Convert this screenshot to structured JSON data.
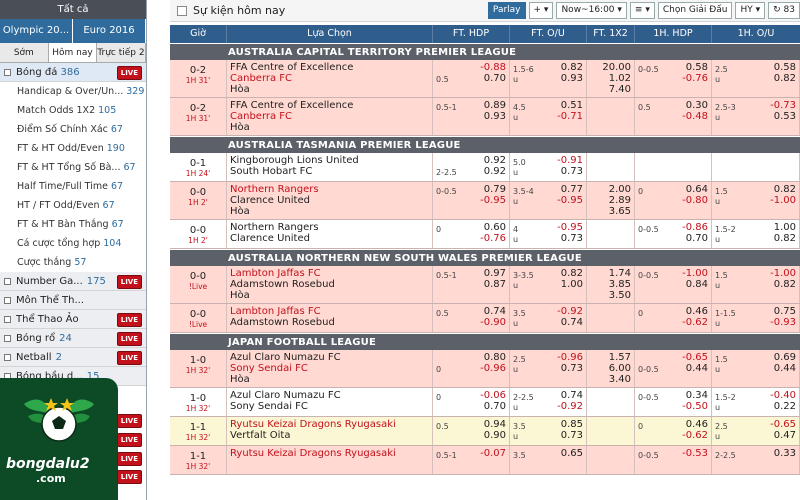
{
  "sidebar": {
    "top_label": "Tất cả",
    "tabs_row1": [
      "Olympic 20...",
      "Euro 2016"
    ],
    "tabs_row2": [
      "Sớm",
      "Hôm nay",
      "Trực tiếp 28"
    ],
    "football": {
      "label": "Bóng đá",
      "count": "386",
      "live": "LIVE"
    },
    "sub_items": [
      {
        "label": "Handicap & Over/Un...",
        "count": "329"
      },
      {
        "label": "Match Odds 1X2",
        "count": "105"
      },
      {
        "label": "Điểm Số Chính Xác",
        "count": "67"
      },
      {
        "label": "FT & HT Odd/Even",
        "count": "190"
      },
      {
        "label": "FT & HT Tổng Số Bà...",
        "count": "67"
      },
      {
        "label": "Half Time/Full Time",
        "count": "67"
      },
      {
        "label": "HT / FT Odd/Even",
        "count": "67"
      },
      {
        "label": "FT & HT Bàn Thắng",
        "count": "67"
      },
      {
        "label": "Cá cược tổng hợp",
        "count": "104"
      },
      {
        "label": "Cược thắng",
        "count": "57"
      }
    ],
    "cats": [
      {
        "label": "Number Ga...",
        "count": "175",
        "live": "LIVE"
      },
      {
        "label": "Môn Thể Th...",
        "count": "",
        "live": ""
      },
      {
        "label": "Thể Thao Ảo",
        "count": "",
        "live": "LIVE"
      },
      {
        "label": "Bóng rổ",
        "count": "24",
        "live": "LIVE"
      },
      {
        "label": "Netball",
        "count": "2",
        "live": "LIVE"
      },
      {
        "label": "Bóng bầu d...",
        "count": "15",
        "live": ""
      }
    ],
    "extra_live": [
      "LIVE",
      "LIVE",
      "LIVE",
      "LIVE"
    ],
    "logo_text": "bongdalu2",
    "logo_domain": ".com"
  },
  "toolbar": {
    "title": "Sự kiện hôm nay",
    "parlay": "Parlay",
    "plus": "+",
    "time_select": "Now~16:00",
    "sort": "≡",
    "choose_league": "Chọn Giải Đấu",
    "odds_type": "HY",
    "refresh": "83"
  },
  "columns": [
    "Giờ",
    "Lựa Chọn",
    "FT. HDP",
    "FT. O/U",
    "FT. 1X2",
    "1H. HDP",
    "1H. O/U"
  ],
  "leagues": [
    {
      "name": "AUSTRALIA CAPITAL TERRITORY PREMIER LEAGUE",
      "matches": [
        {
          "bg": "pink",
          "score": "0-2",
          "min": "1H 31'",
          "home": "FFA Centre of Excellence",
          "away": "Canberra FC",
          "draw": "Hòa",
          "homeRed": false,
          "awayRed": true,
          "hdp": [
            "",
            "-0.88",
            "0.5",
            "0.70"
          ],
          "ou": [
            "1.5-6",
            "0.82",
            "u",
            "0.93"
          ],
          "x12": [
            "20.00",
            "1.02",
            "7.40"
          ],
          "h1": [
            "0-0.5",
            "0.58",
            "",
            "-0.76"
          ],
          "h1ou": [
            "2.5",
            "0.58",
            "u",
            "0.82"
          ]
        },
        {
          "bg": "pink",
          "score": "0-2",
          "min": "1H 31'",
          "home": "FFA Centre of Excellence",
          "away": "Canberra FC",
          "draw": "Hòa",
          "homeRed": false,
          "awayRed": true,
          "hdp": [
            "0.5-1",
            "0.89",
            "",
            "0.93"
          ],
          "ou": [
            "4.5",
            "0.51",
            "u",
            "-0.71"
          ],
          "x12": [
            "",
            "",
            ""
          ],
          "h1": [
            "0.5",
            "0.30",
            "",
            "-0.48"
          ],
          "h1ou": [
            "2.5-3",
            "-0.73",
            "u",
            "0.53"
          ]
        }
      ]
    },
    {
      "name": "AUSTRALIA TASMANIA PREMIER LEAGUE",
      "matches": [
        {
          "bg": "white",
          "score": "0-1",
          "min": "1H 24'",
          "home": "Kingborough Lions United",
          "away": "South Hobart FC",
          "draw": "",
          "homeRed": false,
          "awayRed": false,
          "hdp": [
            "",
            "0.92",
            "2-2.5",
            "0.92"
          ],
          "ou": [
            "5.0",
            "-0.91",
            "u",
            "0.73"
          ],
          "x12": [
            "",
            "",
            ""
          ],
          "h1": [
            "",
            "",
            "",
            ""
          ],
          "h1ou": [
            "",
            "",
            "",
            ""
          ]
        },
        {
          "bg": "pink",
          "score": "0-0",
          "min": "1H 2'",
          "home": "Northern Rangers",
          "away": "Clarence United",
          "draw": "Hòa",
          "homeRed": true,
          "awayRed": false,
          "hdp": [
            "0-0.5",
            "0.79",
            "",
            "-0.95"
          ],
          "ou": [
            "3.5-4",
            "0.77",
            "u",
            "-0.95"
          ],
          "x12": [
            "2.00",
            "2.89",
            "3.65"
          ],
          "h1": [
            "0",
            "0.64",
            "",
            "-0.80"
          ],
          "h1ou": [
            "1.5",
            "0.82",
            "u",
            "-1.00"
          ]
        },
        {
          "bg": "white",
          "score": "0-0",
          "min": "1H 2'",
          "home": "Northern Rangers",
          "away": "Clarence United",
          "draw": "",
          "homeRed": false,
          "awayRed": false,
          "hdp": [
            "0",
            "0.60",
            "",
            "-0.76"
          ],
          "ou": [
            "4",
            "-0.95",
            "u",
            "0.73"
          ],
          "x12": [
            "",
            "",
            ""
          ],
          "h1": [
            "0-0.5",
            "-0.86",
            "",
            "0.70"
          ],
          "h1ou": [
            "1.5-2",
            "1.00",
            "u",
            "0.82"
          ]
        }
      ]
    },
    {
      "name": "AUSTRALIA NORTHERN NEW SOUTH WALES PREMIER LEAGUE",
      "matches": [
        {
          "bg": "pink",
          "score": "0-0",
          "min": "!Live",
          "home": "Lambton Jaffas FC",
          "away": "Adamstown Rosebud",
          "draw": "Hòa",
          "homeRed": true,
          "awayRed": false,
          "hdp": [
            "0.5-1",
            "0.97",
            "",
            "0.87"
          ],
          "ou": [
            "3-3.5",
            "0.82",
            "u",
            "1.00"
          ],
          "x12": [
            "1.74",
            "3.85",
            "3.50"
          ],
          "h1": [
            "0-0.5",
            "-1.00",
            "",
            "0.84"
          ],
          "h1ou": [
            "1.5",
            "-1.00",
            "u",
            "0.82"
          ]
        },
        {
          "bg": "pink",
          "score": "0-0",
          "min": "!Live",
          "home": "Lambton Jaffas FC",
          "away": "Adamstown Rosebud",
          "draw": "",
          "homeRed": true,
          "awayRed": false,
          "hdp": [
            "0.5",
            "0.74",
            "",
            "-0.90"
          ],
          "ou": [
            "3.5",
            "-0.92",
            "u",
            "0.74"
          ],
          "x12": [
            "",
            "",
            ""
          ],
          "h1": [
            "0",
            "0.46",
            "",
            "-0.62"
          ],
          "h1ou": [
            "1-1.5",
            "0.75",
            "u",
            "-0.93"
          ]
        }
      ]
    },
    {
      "name": "JAPAN FOOTBALL LEAGUE",
      "matches": [
        {
          "bg": "pink",
          "score": "1-0",
          "min": "1H 32'",
          "home": "Azul Claro Numazu FC",
          "away": "Sony Sendai FC",
          "draw": "Hòa",
          "homeRed": false,
          "awayRed": true,
          "hdp": [
            "",
            "0.80",
            "0",
            "-0.96"
          ],
          "ou": [
            "2.5",
            "-0.96",
            "u",
            "0.73"
          ],
          "x12": [
            "1.57",
            "6.00",
            "3.40"
          ],
          "h1": [
            "",
            "-0.65",
            "0-0.5",
            "0.44"
          ],
          "h1ou": [
            "1.5",
            "0.69",
            "u",
            "0.44"
          ]
        },
        {
          "bg": "white",
          "score": "1-0",
          "min": "1H 32'",
          "home": "Azul Claro Numazu FC",
          "away": "Sony Sendai FC",
          "draw": "",
          "homeRed": false,
          "awayRed": false,
          "hdp": [
            "0",
            "-0.06",
            "",
            "0.70"
          ],
          "ou": [
            "2-2.5",
            "0.74",
            "u",
            "-0.92"
          ],
          "x12": [
            "",
            "",
            ""
          ],
          "h1": [
            "0-0.5",
            "0.34",
            "",
            "-0.50"
          ],
          "h1ou": [
            "1.5-2",
            "-0.40",
            "u",
            "0.22"
          ]
        },
        {
          "bg": "yellow",
          "score": "1-1",
          "min": "1H 32'",
          "home": "Ryutsu Keizai Dragons Ryugasaki",
          "away": "Vertfalt Oita",
          "draw": "",
          "homeRed": true,
          "awayRed": false,
          "hdp": [
            "0.5",
            "0.94",
            "",
            "0.90"
          ],
          "ou": [
            "3.5",
            "0.85",
            "u",
            "0.73"
          ],
          "x12": [
            "",
            "",
            ""
          ],
          "h1": [
            "0",
            "0.46",
            "",
            "-0.62"
          ],
          "h1ou": [
            "2.5",
            "-0.65",
            "u",
            "0.47"
          ]
        },
        {
          "bg": "pink",
          "score": "1-1",
          "min": "1H 32'",
          "home": "Ryutsu Keizai Dragons Ryugasaki",
          "away": "",
          "draw": "",
          "homeRed": true,
          "awayRed": false,
          "hdp": [
            "0.5-1",
            "-0.07",
            "",
            ""
          ],
          "ou": [
            "3.5",
            "0.65",
            "",
            ""
          ],
          "x12": [
            "",
            "",
            ""
          ],
          "h1": [
            "0-0.5",
            "-0.53",
            "",
            ""
          ],
          "h1ou": [
            "2-2.5",
            "0.33",
            "",
            ""
          ]
        }
      ]
    }
  ]
}
